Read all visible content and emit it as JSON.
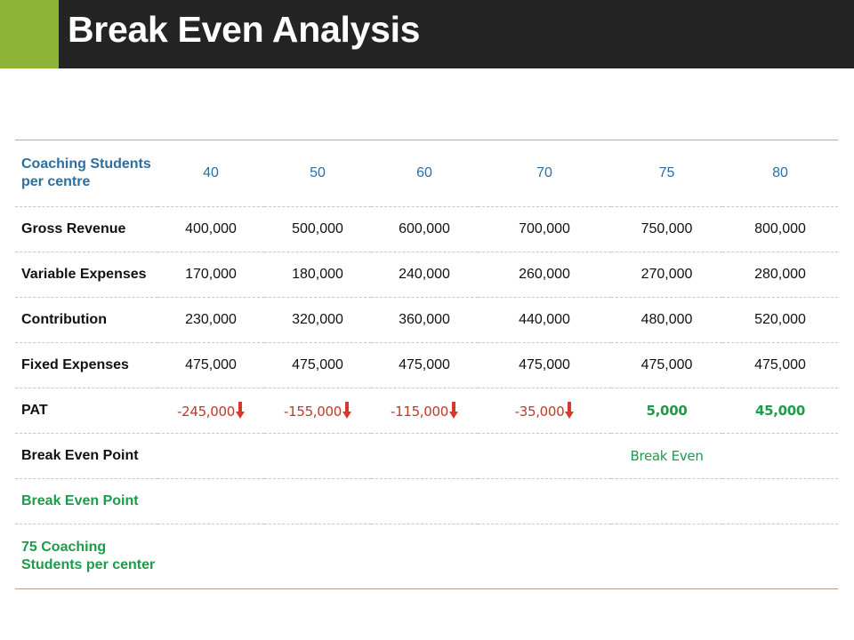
{
  "slide": {
    "title": "Break Even Analysis",
    "colors": {
      "header_bg": "#242424",
      "accent": "#8fb536",
      "negative": "#c0392b",
      "positive": "#1e9b4a",
      "header_text": "#2e6e9e"
    }
  },
  "table": {
    "header": {
      "label": "Coaching Students per centre",
      "values": [
        "40",
        "50",
        "60",
        "70",
        "75",
        "80"
      ]
    },
    "rows": [
      {
        "label": "Gross Revenue",
        "values": [
          "400,000",
          "500,000",
          "600,000",
          "700,000",
          "750,000",
          "800,000"
        ]
      },
      {
        "label": "Variable Expenses",
        "values": [
          "170,000",
          "180,000",
          "240,000",
          "260,000",
          "270,000",
          "280,000"
        ]
      },
      {
        "label": "Contribution",
        "values": [
          "230,000",
          "320,000",
          "360,000",
          "440,000",
          "480,000",
          "520,000"
        ]
      },
      {
        "label": "Fixed Expenses",
        "values": [
          "475,000",
          "475,000",
          "475,000",
          "475,000",
          "475,000",
          "475,000"
        ]
      }
    ],
    "pat": {
      "label": "PAT",
      "values": [
        "-245,000",
        "-155,000",
        "-115,000",
        "-35,000",
        "5,000",
        "45,000"
      ],
      "icon": "down-arrow-icon"
    },
    "break_even_row": {
      "label": "Break Even Point",
      "marker": "Break Even"
    },
    "summary_title": "Break Even Point",
    "summary_text": "75 Coaching Students per center"
  }
}
